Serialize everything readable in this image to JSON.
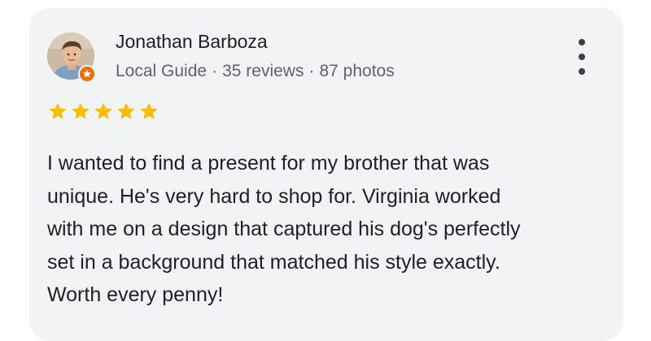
{
  "review": {
    "author": {
      "name": "Jonathan Barboza",
      "badge": "Local Guide",
      "reviews": "35 reviews",
      "photos": "87 photos",
      "separator": "·"
    },
    "rating": {
      "value": 5,
      "max": 5,
      "star_color": "#fbbc04"
    },
    "text": "I wanted to find a present for my brother that was\nunique. He's very hard to shop for. Virginia worked\nwith me on a design that captured his dog's perfectly\nset in a background that matched his style exactly.\nWorth every penny!"
  },
  "icons": {
    "more": "more-vert-icon",
    "guide_badge": "local-guide-star-icon",
    "star": "star-icon"
  },
  "colors": {
    "card_background": "#f1f3f4",
    "guide_badge": "#e8710a"
  }
}
